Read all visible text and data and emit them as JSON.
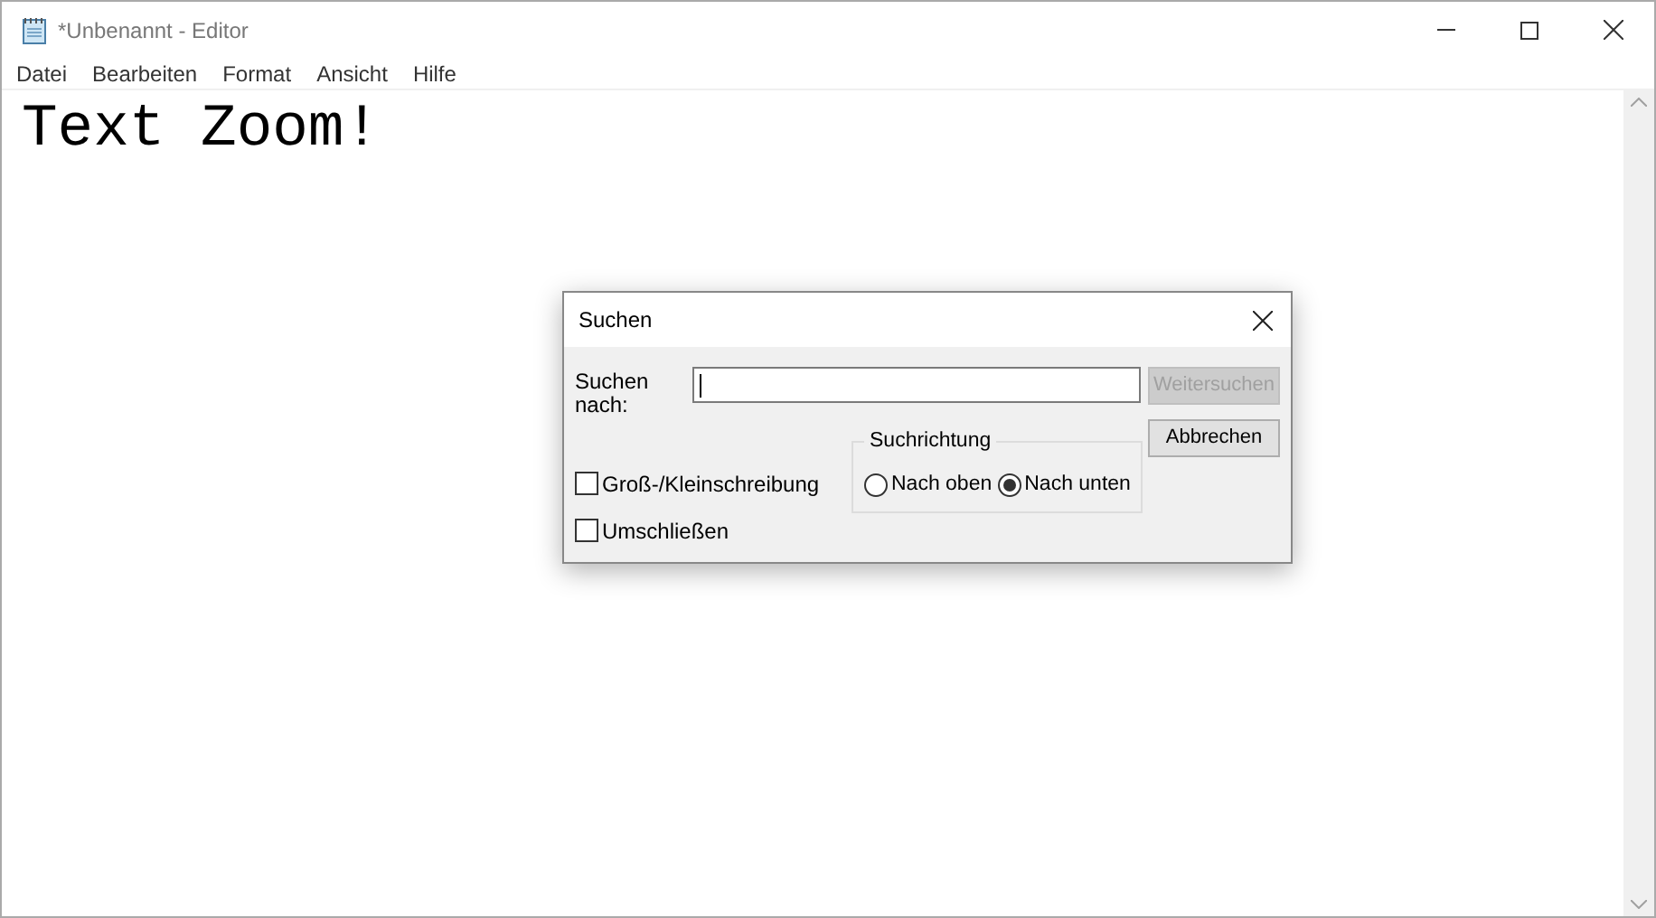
{
  "window": {
    "title": "*Unbenannt - Editor"
  },
  "menu": [
    "Datei",
    "Bearbeiten",
    "Format",
    "Ansicht",
    "Hilfe"
  ],
  "editor": {
    "text": "Text Zoom!"
  },
  "dialog": {
    "title": "Suchen",
    "search_label": "Suchen nach:",
    "buttons": [
      {
        "label": "Weitersuchen",
        "disabled": true
      },
      {
        "label": "Abbrechen",
        "disabled": false
      }
    ],
    "direction": {
      "title": "Suchrichtung",
      "options": [
        {
          "label": "Nach oben",
          "selected": false
        },
        {
          "label": "Nach unten",
          "selected": true
        }
      ]
    },
    "checkboxes": [
      {
        "label": "Groß-/Kleinschreibung",
        "checked": false
      },
      {
        "label": "Umschließen",
        "checked": false
      }
    ]
  }
}
